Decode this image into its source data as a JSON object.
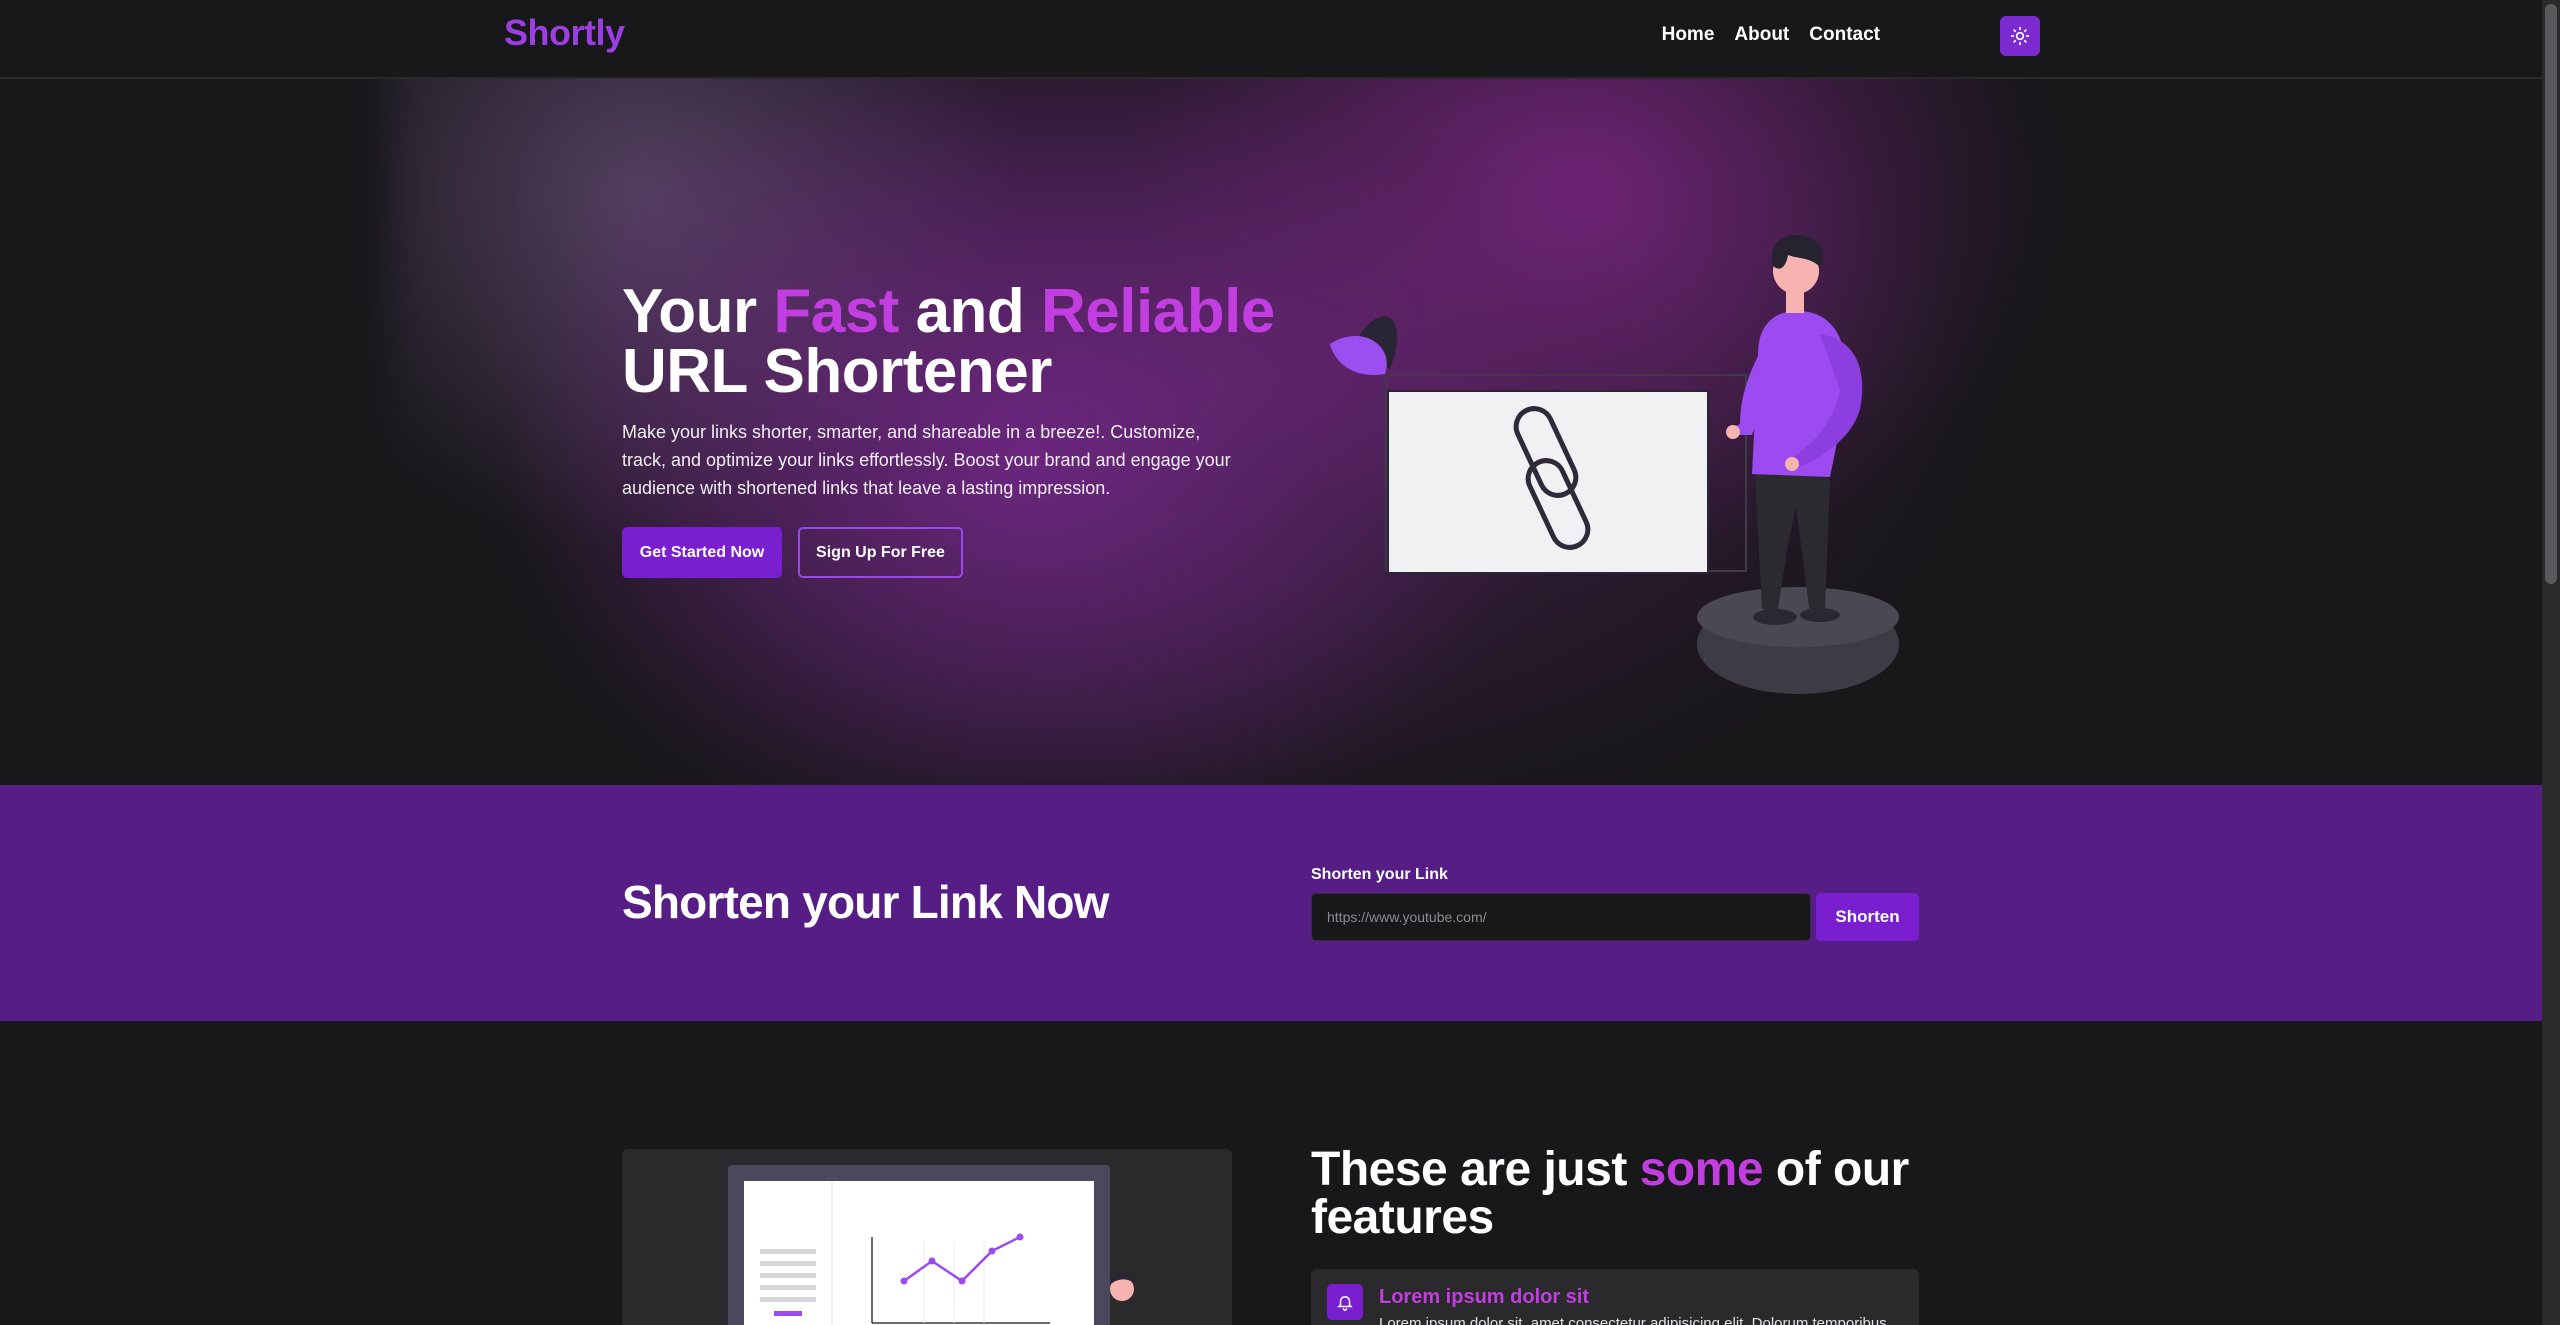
{
  "nav": {
    "brand": "Shortly",
    "links": [
      "Home",
      "About",
      "Contact"
    ],
    "theme_icon": "sun-icon"
  },
  "hero": {
    "title_parts": [
      "Your ",
      "Fast",
      " and ",
      "Reliable",
      "URL Shortener"
    ],
    "description": "Make your links shorter, smarter, and shareable in a breeze!. Customize, track, and optimize your links effortlessly. Boost your brand and engage your audience with shortened links that leave a lasting impression.",
    "primary_button": "Get Started Now",
    "secondary_button": "Sign Up For Free",
    "illustration_icon": "link-chain-icon"
  },
  "shorten": {
    "title": "Shorten your Link Now",
    "label": "Shorten your Link",
    "placeholder": "https://www.youtube.com/",
    "button": "Shorten"
  },
  "features": {
    "title_parts": [
      "These are just ",
      "some",
      " of our features"
    ],
    "items": [
      {
        "icon": "bell-icon",
        "title": "Lorem ipsum dolor sit",
        "text": "Lorem ipsum dolor sit, amet consectetur adipisicing elit. Dolorum temporibus"
      }
    ]
  },
  "colors": {
    "brand": "#9b3fe3",
    "accent": "#c23ee0",
    "primary_button": "#7a1fd0",
    "band": "#561e85",
    "background": "#18171a"
  }
}
